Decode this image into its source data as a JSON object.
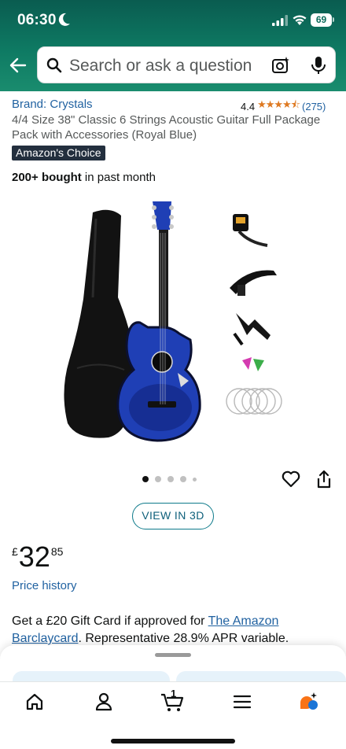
{
  "status_bar": {
    "time": "06:30",
    "battery": "69"
  },
  "header": {
    "search_placeholder": "Search or ask a question"
  },
  "product": {
    "brand": "Brand: Crystals",
    "rating_value": "4.4",
    "rating_stars": "★★★★⯪",
    "rating_count": "(275)",
    "title": "4/4 Size 38\" Classic 6 Strings Acoustic Guitar Full Package Pack with Accessories (Royal Blue)",
    "badge": "Amazon's Choice",
    "bought_strong": "200+ bought",
    "bought_rest": " in past month"
  },
  "carousel": {
    "view_3d": "VIEW IN 3D"
  },
  "price": {
    "symbol": "£",
    "whole": "32",
    "fraction": "85",
    "history_link": "Price history"
  },
  "promo": {
    "text_before": "Get a £20 Gift Card if approved for ",
    "link": "The Amazon Barclaycard",
    "text_after": ". Representative 28.9% APR variable."
  },
  "tabbar": {
    "cart_count": "1"
  },
  "colors": {
    "header_green": "#0e7a63",
    "link_blue": "#2162a1",
    "star_orange": "#de7921",
    "badge_navy": "#232f3e",
    "guitar_blue": "#1f3fb5"
  }
}
